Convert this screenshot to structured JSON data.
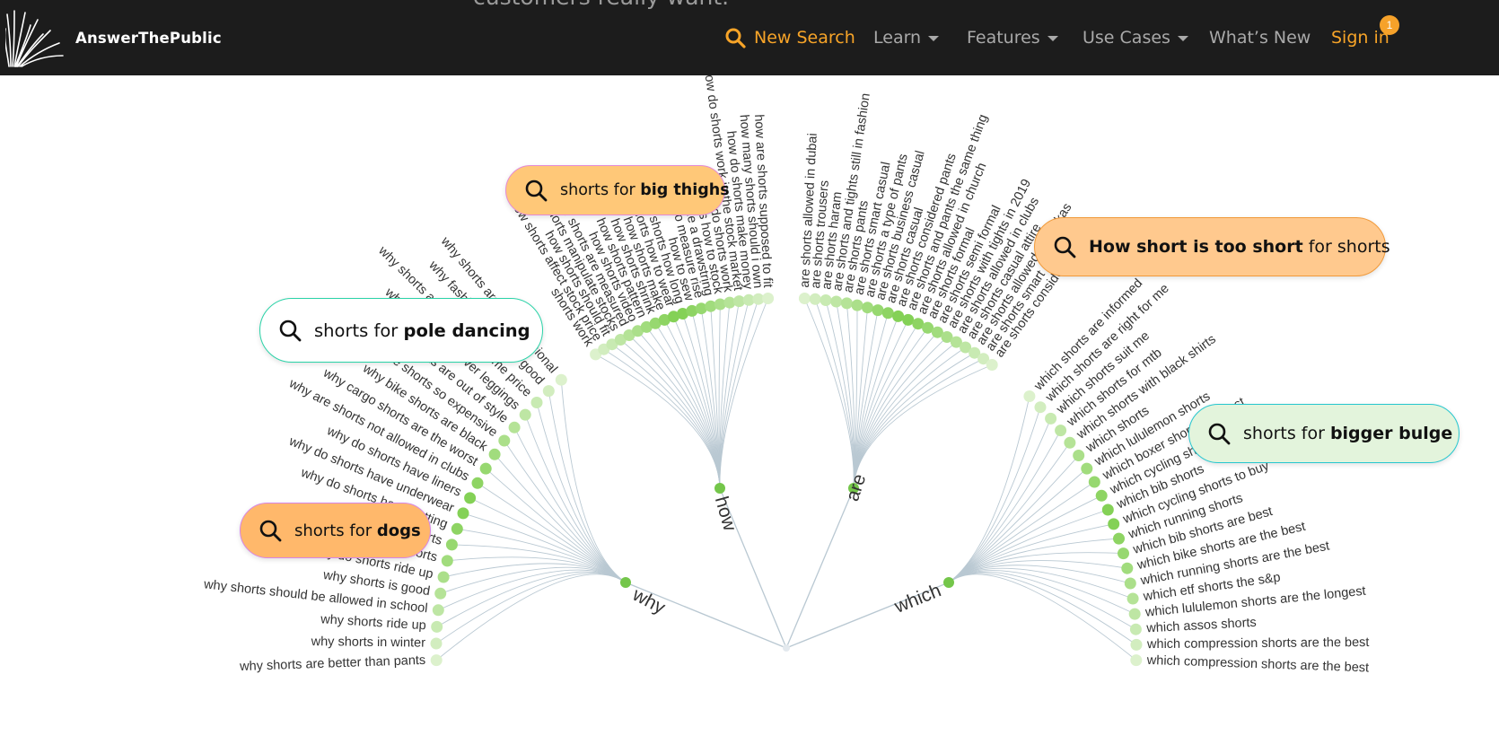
{
  "header": {
    "hero_fragment": "customers really want.",
    "brand_name": "AnswerThePublic",
    "nav": {
      "new_search": "New Search",
      "learn": "Learn",
      "features": "Features",
      "use_cases": "Use Cases",
      "whats_new": "What’s New",
      "whats_new_badge": "1",
      "sign_in": "Sign in"
    },
    "accent_color": "#f7a428"
  },
  "wheel": {
    "branches": [
      {
        "name": "why",
        "items": [
          "why shorts are better than pants",
          "why shorts in winter",
          "why shorts ride up",
          "why shorts should be allowed in school",
          "why shorts is good",
          "why do shorts ride up",
          "why compression shorts",
          "why bib shorts",
          "why do shorts have netting",
          "why do shorts have underwear",
          "why do shorts have liners",
          "why are shorts not allowed in clubs",
          "why cargo shorts are the worst",
          "why bike shorts are black",
          "why are shorts so expensive",
          "why cargo shorts are out of style",
          "why wear shorts over leggings",
          "why shorts and 100s the same price",
          "why fashion shorts are good",
          "why shorts are unprofessional"
        ]
      },
      {
        "name": "how",
        "items": [
          "shorts work",
          "how shorts affect stock price",
          "how shorts should fit",
          "how shorts manipulate stocks",
          "how shorts are measured",
          "how shorts video",
          "how shorts pattern",
          "how shorts shrink",
          "how shorts make",
          "how shorts how to wear",
          "shorts how long",
          "how to sew",
          "how to measure rise",
          "how to tie a drawstring",
          "shorts how to stock",
          "how do shorts work",
          "how do shorts work in the stock market",
          "how do shorts make money",
          "how many shorts should i own",
          "how are shorts supposed to fit"
        ]
      },
      {
        "name": "are",
        "items": [
          "are shorts allowed in dubai",
          "are shorts trousers",
          "are shorts haram",
          "are shorts and tights still in fashion",
          "are shorts pants",
          "are shorts smart casual",
          "are shorts a type of pants",
          "are shorts business casual",
          "are shorts casual",
          "are shorts considered pants",
          "are shorts and pants the same thing",
          "are shorts allowed in church",
          "are shorts formal",
          "are shorts semi formal",
          "are shorts with tights in 2019",
          "are shorts allowed in clubs",
          "are shorts casual attire",
          "are shorts allowed in angkas",
          "are shorts smart casual",
          "are shorts considered pants"
        ]
      },
      {
        "name": "which",
        "items": [
          "which shorts are informed",
          "which shorts are right for me",
          "which shorts suit me",
          "which shorts for mtb",
          "which shorts with black shirts",
          "which shorts",
          "which lululemon shorts",
          "which boxer shorts are best",
          "which cycling shorts",
          "which bib shorts",
          "which cycling shorts to buy",
          "which running shorts",
          "which bib shorts are best",
          "which bike shorts are the best",
          "which running shorts are the best",
          "which etf shorts the s&p",
          "which lululemon shorts are the longest",
          "which assos shorts",
          "which compression shorts are the best",
          "which compression shorts are the best"
        ]
      }
    ],
    "colors": {
      "strong_dot": "#7fcf4f",
      "light_dot": "#e8f5dc",
      "spoke": "#b9c8d2",
      "hub_dot": "#74c64a"
    }
  },
  "pills": {
    "big_thighs": {
      "prefix": "shorts for ",
      "bold": "big thighs",
      "suffix": ""
    },
    "pole_dancing": {
      "prefix": "shorts for ",
      "bold": "pole dancing",
      "suffix": ""
    },
    "too_short": {
      "prefix": "",
      "bold": "How short is too short",
      "suffix": " for shorts"
    },
    "bigger_bulge": {
      "prefix": "shorts for ",
      "bold": "bigger bulge",
      "suffix": ""
    },
    "dogs": {
      "prefix": "shorts for ",
      "bold": "dogs",
      "suffix": ""
    }
  }
}
